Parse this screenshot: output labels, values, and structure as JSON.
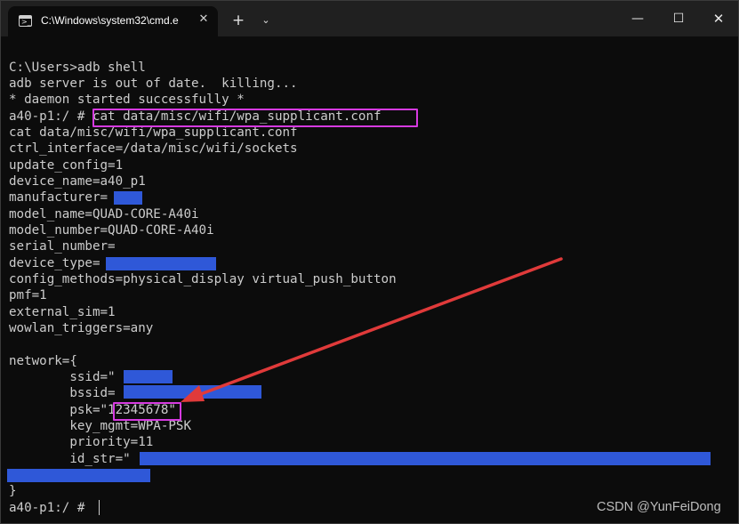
{
  "window": {
    "tab_title": "C:\\Windows\\system32\\cmd.e",
    "tab_icon_glyph": ">_",
    "close_tab_glyph": "✕",
    "new_tab_glyph": "+",
    "dropdown_glyph": "⌄",
    "minimize_glyph": "—",
    "maximize_glyph": "☐",
    "close_glyph": "✕"
  },
  "terminal": {
    "lines": [
      "C:\\Users>adb shell",
      "adb server is out of date.  killing...",
      "* daemon started successfully *",
      "a40-p1:/ # cat data/misc/wifi/wpa_supplicant.conf",
      "cat data/misc/wifi/wpa_supplicant.conf",
      "ctrl_interface=/data/misc/wifi/sockets",
      "update_config=1",
      "device_name=a40_p1",
      "manufacturer=",
      "model_name=QUAD-CORE-A40i",
      "model_number=QUAD-CORE-A40i",
      "serial_number=",
      "device_type=",
      "config_methods=physical_display virtual_push_button",
      "pmf=1",
      "external_sim=1",
      "wowlan_triggers=any",
      "",
      "network={",
      "        ssid=\"      \"",
      "        bssid=",
      "        psk=\"12345678\"",
      "        key_mgmt=WPA-PSK",
      "        priority=11",
      "        id_str=\"",
      "                \"",
      "}",
      "a40-p1:/ # "
    ]
  },
  "colors": {
    "terminal_bg": "#0c0c0c",
    "terminal_fg": "#cccccc",
    "annotation": "#d63ae0",
    "arrow": "#e03a3a",
    "redaction": "#2f58d8"
  },
  "watermark": "CSDN @YunFeiDong"
}
